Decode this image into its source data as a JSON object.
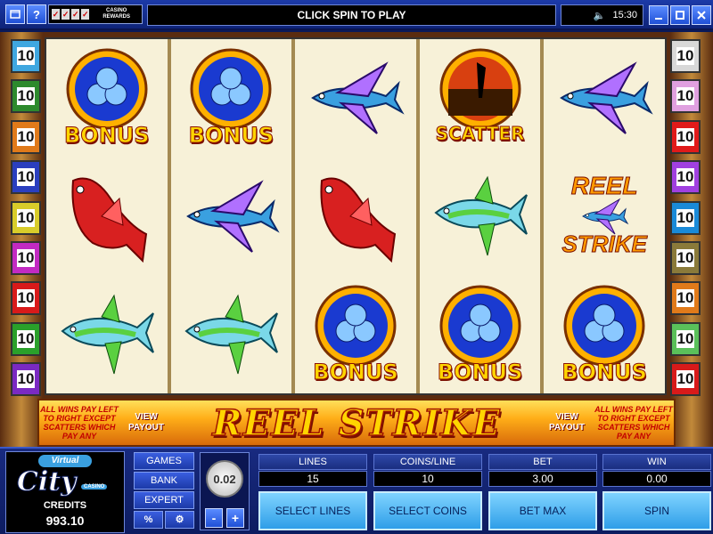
{
  "topbar": {
    "message": "CLICK SPIN TO PLAY",
    "time": "15:30",
    "help_label": "?",
    "rewards_label": "CASINO REWARDS"
  },
  "paylines": {
    "left": [
      "10",
      "10",
      "10",
      "10",
      "10",
      "10",
      "10",
      "10",
      "10"
    ],
    "right": [
      "10",
      "10",
      "10",
      "10",
      "10",
      "10",
      "10",
      "10",
      "10"
    ],
    "left_colors": [
      "#3fa7e0",
      "#2d8a2d",
      "#e07a1a",
      "#2a3fbf",
      "#d8cc2a",
      "#c22ac2",
      "#d81a1a",
      "#2aa02a",
      "#7a2ac2"
    ],
    "right_colors": [
      "#d8d8d8",
      "#e0a0e0",
      "#e01a1a",
      "#a040e0",
      "#1a8ad8",
      "#8a7a3a",
      "#e07a1a",
      "#5ac05a",
      "#d81a1a"
    ]
  },
  "reels": [
    [
      "bonus",
      "red-fish",
      "tuna"
    ],
    [
      "bonus",
      "flying-fish",
      "tuna"
    ],
    [
      "flying-fish",
      "red-fish",
      "bonus"
    ],
    [
      "scatter",
      "tuna",
      "bonus"
    ],
    [
      "flying-fish",
      "reel-strike-wild",
      "bonus"
    ]
  ],
  "symbol_text": {
    "bonus": "BONUS",
    "scatter": "SCATTER",
    "wild_top": "REEL",
    "wild_bottom": "STRIKE"
  },
  "banner": {
    "rules_left": "ALL WINS PAY LEFT TO RIGHT EXCEPT SCATTERS WHICH PAY ANY",
    "rules_right": "ALL WINS PAY LEFT TO RIGHT EXCEPT SCATTERS WHICH PAY ANY",
    "view_payout_left": "VIEW PAYOUT",
    "view_payout_right": "VIEW PAYOUT",
    "title": "REEL STRIKE"
  },
  "logo": {
    "top": "Virtual",
    "word": "City",
    "casino": "CASINO"
  },
  "credits": {
    "label": "CREDITS",
    "value": "993.10"
  },
  "menu": {
    "games": "GAMES",
    "bank": "BANK",
    "expert": "EXPERT",
    "percent": "%",
    "settings_glyph": "⚙"
  },
  "coin": {
    "value": "0.02",
    "minus": "-",
    "plus": "+"
  },
  "stats": {
    "lines_label": "LINES",
    "lines": "15",
    "coins_label": "COINS/LINE",
    "coins": "10",
    "bet_label": "BET",
    "bet": "3.00",
    "win_label": "WIN",
    "win": "0.00"
  },
  "buttons": {
    "select_lines": "SELECT LINES",
    "select_coins": "SELECT COINS",
    "bet_max": "BET MAX",
    "spin": "SPIN"
  },
  "colors": {
    "accent": "#1c3aa8",
    "button": "#2e9ee8"
  }
}
